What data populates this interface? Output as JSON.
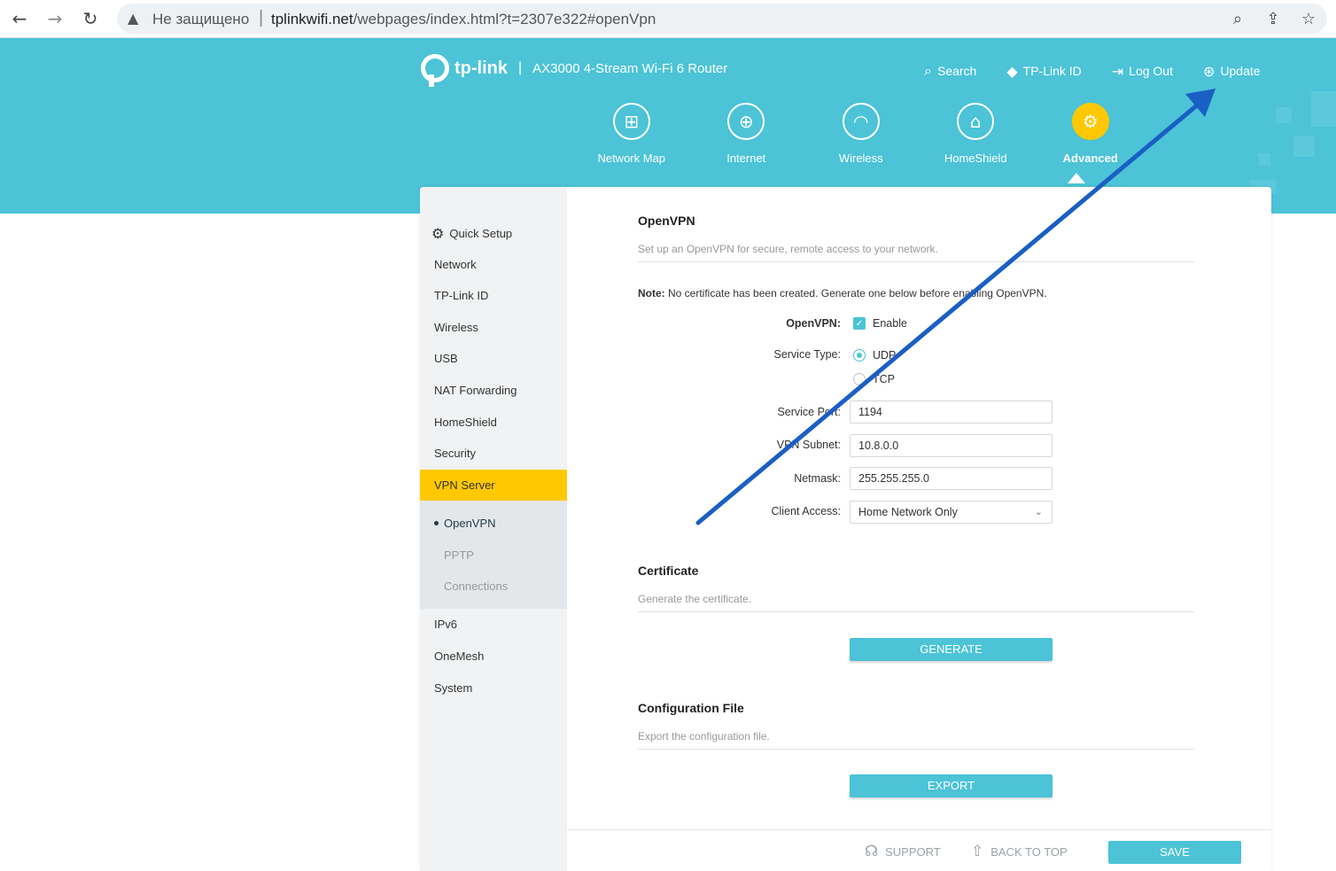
{
  "browser": {
    "insecure_label": "Не защищено",
    "url_host": "tplinkwifi.net",
    "url_path": "/webpages/index.html?t=2307e322#openVpn",
    "icons": [
      "back-icon",
      "forward-icon",
      "reload-icon",
      "warning-icon",
      "zoom-icon",
      "share-icon",
      "star-icon"
    ]
  },
  "header": {
    "brand": "tp-link",
    "separator": "|",
    "model": "AX3000 4-Stream Wi-Fi 6 Router",
    "top_links": [
      {
        "label": "Search",
        "icon": "search-icon"
      },
      {
        "label": "TP-Link ID",
        "icon": "tplink-id-icon"
      },
      {
        "label": "Log Out",
        "icon": "logout-icon"
      },
      {
        "label": "Update",
        "icon": "update-icon"
      }
    ],
    "nav": [
      {
        "label": "Network Map",
        "icon": "network-map-icon"
      },
      {
        "label": "Internet",
        "icon": "globe-icon"
      },
      {
        "label": "Wireless",
        "icon": "wifi-icon"
      },
      {
        "label": "HomeShield",
        "icon": "home-shield-icon"
      },
      {
        "label": "Advanced",
        "icon": "gear-icon",
        "active": true
      }
    ],
    "colors": {
      "header_bg": "#4cc3d6",
      "active": "#ffc800"
    }
  },
  "sidebar": {
    "items": [
      {
        "label": "Quick Setup"
      },
      {
        "label": "Network"
      },
      {
        "label": "TP-Link ID"
      },
      {
        "label": "Wireless"
      },
      {
        "label": "USB"
      },
      {
        "label": "NAT Forwarding"
      },
      {
        "label": "HomeShield"
      },
      {
        "label": "Security"
      },
      {
        "label": "VPN Server",
        "active": true
      },
      {
        "label": "IPv6"
      },
      {
        "label": "OneMesh"
      },
      {
        "label": "System"
      }
    ],
    "sub_items": [
      {
        "label": "OpenVPN",
        "active": true
      },
      {
        "label": "PPTP"
      },
      {
        "label": "Connections"
      }
    ]
  },
  "openvpn": {
    "title": "OpenVPN",
    "desc": "Set up an OpenVPN for secure, remote access to your network.",
    "note_bold": "Note:",
    "note_text": " No certificate has been created. Generate one below before enabling OpenVPN.",
    "fields": {
      "openvpn_label": "OpenVPN:",
      "enable_label": "Enable",
      "enable_checked": true,
      "service_type_label": "Service Type:",
      "udp_label": "UDP",
      "tcp_label": "TCP",
      "service_type_selected": "UDP",
      "service_port_label": "Service Port:",
      "service_port": "1194",
      "vpn_subnet_label": "VPN Subnet:",
      "vpn_subnet": "10.8.0.0",
      "netmask_label": "Netmask:",
      "netmask": "255.255.255.0",
      "client_access_label": "Client Access:",
      "client_access": "Home Network Only"
    }
  },
  "certificate": {
    "title": "Certificate",
    "desc": "Generate the certificate.",
    "button": "GENERATE"
  },
  "config_file": {
    "title": "Configuration File",
    "desc": "Export the configuration file.",
    "button": "EXPORT"
  },
  "footer": {
    "support": "SUPPORT",
    "back_to_top": "BACK TO TOP",
    "save": "SAVE"
  },
  "annotation": {
    "type": "arrow",
    "color": "#1a5fc4",
    "points_to": "Update"
  }
}
